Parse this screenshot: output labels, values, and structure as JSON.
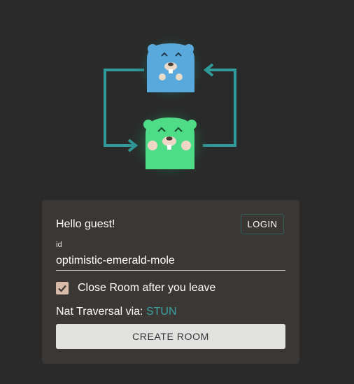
{
  "card": {
    "greeting": "Hello guest!",
    "login_label": "LOGIN",
    "id_label": "id",
    "id_value": "optimistic-emerald-mole",
    "close_room_checked": true,
    "close_room_label": "Close Room after you leave",
    "nat_label": "Nat Traversal via: ",
    "nat_value": "STUN",
    "create_label": "CREATE ROOM"
  },
  "colors": {
    "background": "#292a29",
    "card": "#3a3735",
    "accent": "#3ba3a3",
    "gopher_top": "#5aa9dd",
    "gopher_bottom": "#4fdc86",
    "arrows": "#2e9a9a"
  },
  "icons": {
    "hero": "gophers-exchange-illustration",
    "checkbox": "check-icon"
  }
}
